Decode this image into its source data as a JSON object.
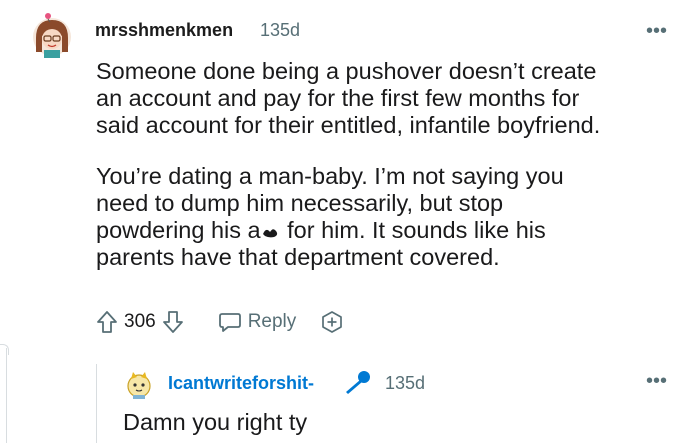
{
  "comment": {
    "username": "mrsshmenkmen",
    "age": "135d",
    "more_label": "•••",
    "paragraph1": [
      "Someone done being a pushover doesn’t create",
      "an account and pay for the first few months for",
      "said account for their entitled, infantile boyfriend."
    ],
    "paragraph2_line1": "You’re dating a man-baby. I’m not saying you",
    "paragraph2_line2": "need to dump him necessarily, but stop",
    "paragraph2_line3_before": "powdering his a",
    "paragraph2_line3_after": " for him. It sounds like his",
    "paragraph2_line4": "parents have that department covered.",
    "score": "306",
    "reply_label": "Reply"
  },
  "reply": {
    "username": "Icantwriteforshit-",
    "age": "135d",
    "more_label": "•••",
    "text": "Damn you right ty"
  },
  "colors": {
    "username_blue": "#0079d3",
    "meta_gray": "#576f76",
    "thread_line": "#d8dde0"
  }
}
